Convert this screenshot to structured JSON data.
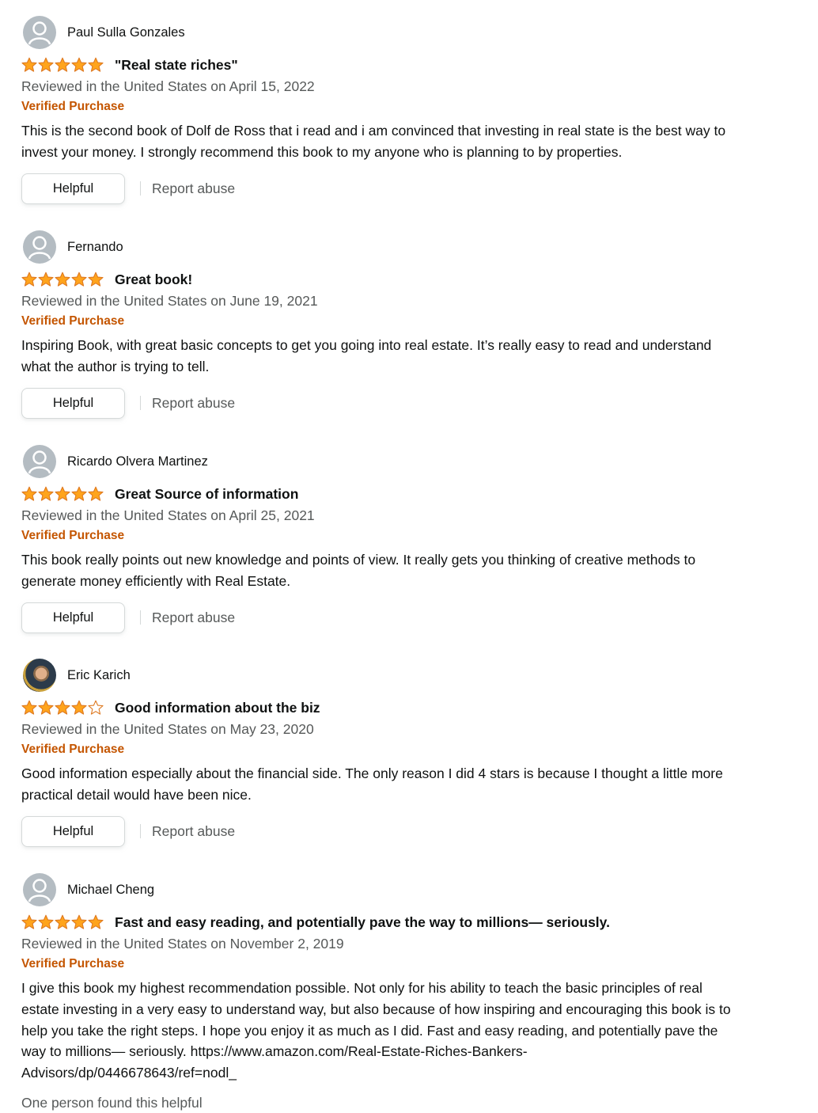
{
  "colors": {
    "star": "#ffa41c",
    "star_outline": "#de7921",
    "verified": "#c45500",
    "secondary_text": "#565959"
  },
  "reviews": [
    {
      "name": "Paul Sulla Gonzales",
      "rating": 5,
      "title": "\"Real state riches\"",
      "date": "Reviewed in the United States on April 15, 2022",
      "verified": "Verified Purchase",
      "body": "This is the second book of Dolf de Ross that i read and i am convinced that investing in real state is the best way to invest your money. I strongly recommend this book to my anyone who is planning to by properties.",
      "helpful_label": "Helpful",
      "report_label": "Report abuse"
    },
    {
      "name": "Fernando",
      "rating": 5,
      "title": "Great book!",
      "date": "Reviewed in the United States on June 19, 2021",
      "verified": "Verified Purchase",
      "body": "Inspiring Book, with great basic concepts to get you going into real estate. It’s really easy to read and understand what the author is trying to tell.",
      "helpful_label": "Helpful",
      "report_label": "Report abuse"
    },
    {
      "name": "Ricardo Olvera Martinez",
      "rating": 5,
      "title": "Great Source of information",
      "date": "Reviewed in the United States on April 25, 2021",
      "verified": "Verified Purchase",
      "body": "This book really points out new knowledge and points of view. It really gets you thinking of creative methods to generate money efficiently with Real Estate.",
      "helpful_label": "Helpful",
      "report_label": "Report abuse"
    },
    {
      "name": "Eric Karich",
      "rating": 4,
      "title": "Good information about the biz",
      "date": "Reviewed in the United States on May 23, 2020",
      "verified": "Verified Purchase",
      "body": "Good information especially about the financial side. The only reason I did 4 stars is because I thought a little more practical detail would have been nice.",
      "helpful_label": "Helpful",
      "report_label": "Report abuse"
    },
    {
      "name": "Michael Cheng",
      "rating": 5,
      "title": "Fast and easy reading, and potentially pave the way to millions— seriously.",
      "date": "Reviewed in the United States on November 2, 2019",
      "verified": "Verified Purchase",
      "body": "I give this book my highest recommendation possible. Not only for his ability to teach the basic principles of real estate investing in a very easy to understand way, but also because of how inspiring and encouraging this book is to help you take the right steps. I hope you enjoy it as much as I did. Fast and easy reading, and potentially pave the way to millions— seriously. https://www.amazon.com/Real-Estate-Riches-Bankers-Advisors/dp/0446678643/ref=nodl_",
      "helpful_count": "One person found this helpful"
    }
  ]
}
